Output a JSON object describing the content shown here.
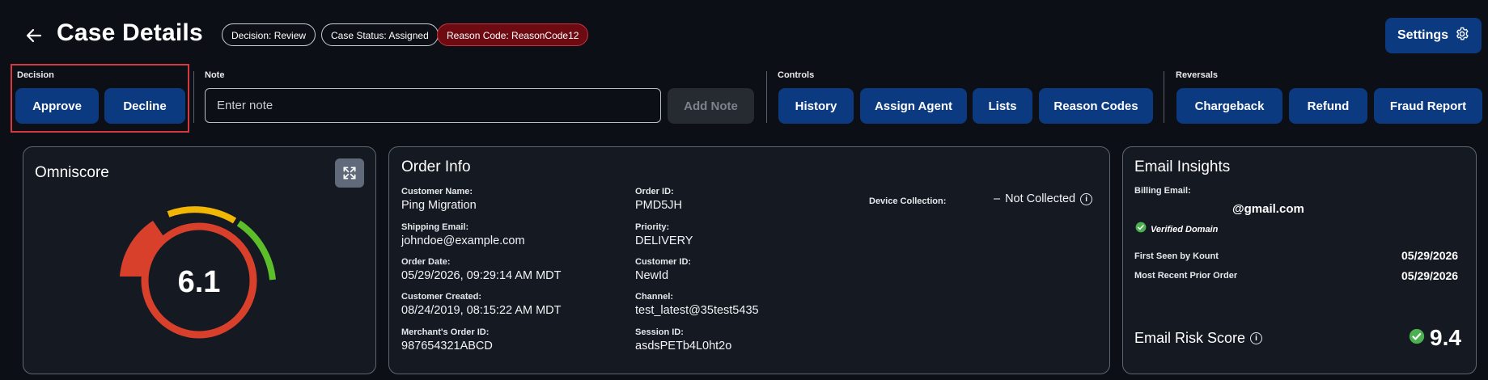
{
  "header": {
    "title": "Case Details",
    "badges": {
      "decision": "Decision: Review",
      "case_status": "Case Status: Assigned",
      "reason_code": "Reason Code: ReasonCode12"
    },
    "settings_label": "Settings"
  },
  "toolbar": {
    "decision": {
      "label": "Decision",
      "approve": "Approve",
      "decline": "Decline"
    },
    "note": {
      "label": "Note",
      "placeholder": "Enter note",
      "value": "",
      "add_label": "Add Note"
    },
    "controls": {
      "label": "Controls",
      "history": "History",
      "assign_agent": "Assign Agent",
      "lists": "Lists",
      "reason_codes": "Reason Codes"
    },
    "reversals": {
      "label": "Reversals",
      "chargeback": "Chargeback",
      "refund": "Refund",
      "fraud_report": "Fraud Report"
    }
  },
  "omniscore": {
    "title": "Omniscore",
    "score": "6.1",
    "score_value": 6.1,
    "colors": {
      "red": "#d9402c",
      "amber": "#f2b705",
      "green": "#5cbf2a"
    }
  },
  "order_info": {
    "title": "Order Info",
    "fields": {
      "customer_name": {
        "label": "Customer Name:",
        "value": "Ping Migration"
      },
      "shipping_email": {
        "label": "Shipping Email:",
        "value": "johndoe@example.com"
      },
      "order_date": {
        "label": "Order Date:",
        "value": "05/29/2026, 09:29:14 AM MDT"
      },
      "customer_created": {
        "label": "Customer Created:",
        "value": "08/24/2019, 08:15:22 AM MDT"
      },
      "merchant_order_id": {
        "label": "Merchant's Order ID:",
        "value": "987654321ABCD"
      },
      "order_id": {
        "label": "Order ID:",
        "value": "PMD5JH"
      },
      "priority": {
        "label": "Priority:",
        "value": "DELIVERY"
      },
      "customer_id": {
        "label": "Customer ID:",
        "value": "NewId"
      },
      "channel": {
        "label": "Channel:",
        "value": "test_latest@35test5435"
      },
      "session_id": {
        "label": "Session ID:",
        "value": "asdsPETb4L0ht2o"
      },
      "device_collection": {
        "label": "Device Collection:",
        "value": "Not Collected",
        "dash": "–"
      }
    }
  },
  "email_insights": {
    "title": "Email Insights",
    "billing_email_label": "Billing Email:",
    "billing_email": "@gmail.com",
    "verified_label": "Verified Domain",
    "first_seen_label": "First Seen by Kount",
    "first_seen": "05/29/2026",
    "recent_order_label": "Most Recent Prior Order",
    "recent_order": "05/29/2026",
    "risk_label": "Email Risk Score",
    "risk_score": "9.4"
  },
  "icons": {
    "back": "arrow-left",
    "settings": "gear",
    "expand": "expand-arrows",
    "info": "info-circle",
    "check": "check-circle"
  },
  "colors": {
    "background": "#0c0f15",
    "card": "#141922",
    "primary_button": "#0b3a80",
    "reason_badge": "#6e0b12",
    "highlight_border": "#d9383f",
    "verified_green": "#4caf50"
  }
}
